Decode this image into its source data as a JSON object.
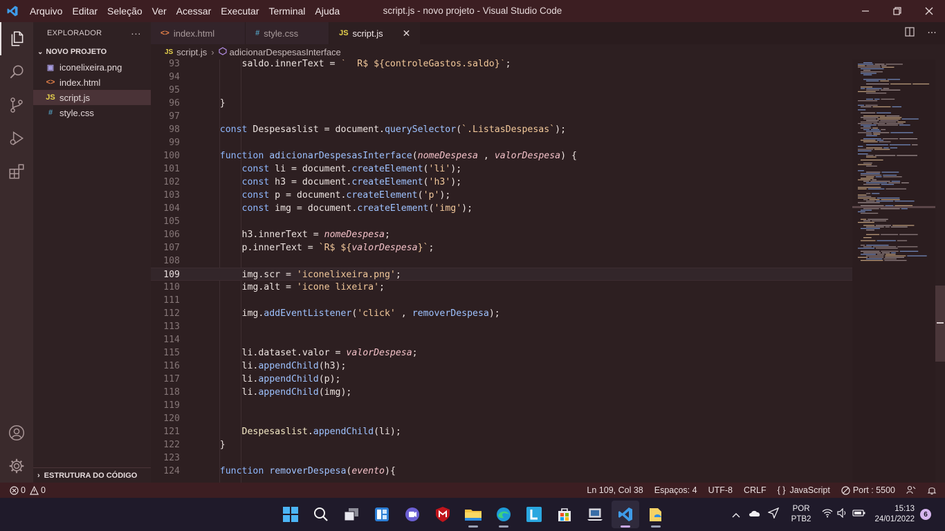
{
  "app": {
    "window_title": "script.js - novo projeto - Visual Studio Code",
    "menu": [
      "Arquivo",
      "Editar",
      "Seleção",
      "Ver",
      "Acessar",
      "Executar",
      "Terminal",
      "Ajuda"
    ]
  },
  "sidebar": {
    "header": "EXPLORADOR",
    "more": "···",
    "project": "NOVO PROJETO",
    "files": [
      {
        "name": "iconelixeira.png",
        "icon": "image-file-icon",
        "glyph": "▣",
        "color": "#a79ce0"
      },
      {
        "name": "index.html",
        "icon": "html-file-icon",
        "glyph": "<>",
        "color": "#e8824a"
      },
      {
        "name": "script.js",
        "icon": "js-file-icon",
        "glyph": "JS",
        "color": "#e8d44d"
      },
      {
        "name": "style.css",
        "icon": "css-file-icon",
        "glyph": "#",
        "color": "#519aba"
      }
    ],
    "outline": "ESTRUTURA DO CÓDIGO"
  },
  "tabs": [
    {
      "label": "index.html",
      "glyph": "<>",
      "color": "#e8824a",
      "active": false
    },
    {
      "label": "style.css",
      "glyph": "#",
      "color": "#519aba",
      "active": false
    },
    {
      "label": "script.js",
      "glyph": "JS",
      "color": "#e8d44d",
      "active": true
    }
  ],
  "breadcrumb": {
    "file": "script.js",
    "file_glyph": "JS",
    "symbol": "adicionarDespesasInterface"
  },
  "editor": {
    "current_line": 109,
    "lines": [
      {
        "n": 93,
        "html": "        saldo.innerText = <span class='st'>`  R$ ${controleGastos.saldo}`</span>;"
      },
      {
        "n": 94,
        "html": ""
      },
      {
        "n": 95,
        "html": ""
      },
      {
        "n": 96,
        "html": "    }"
      },
      {
        "n": 97,
        "html": ""
      },
      {
        "n": 98,
        "html": "    <span class='kw'>const</span> Despesaslist = document.<span class='fn'>querySelector</span>(<span class='st'>`.ListasDespesas`</span>);"
      },
      {
        "n": 99,
        "html": ""
      },
      {
        "n": 100,
        "html": "    <span class='kw'>function</span> <span class='fn'>adicionarDespesasInterface</span>(<span class='pa'>nomeDespesa</span> , <span class='pa'>valorDespesa</span>) {"
      },
      {
        "n": 101,
        "html": "        <span class='kw'>const</span> li = document.<span class='fn'>createElement</span>(<span class='st'>'li'</span>);"
      },
      {
        "n": 102,
        "html": "        <span class='kw'>const</span> h3 = document.<span class='fn'>createElement</span>(<span class='st'>'h3'</span>);"
      },
      {
        "n": 103,
        "html": "        <span class='kw'>const</span> p = document.<span class='fn'>createElement</span>(<span class='st'>'p'</span>);"
      },
      {
        "n": 104,
        "html": "        <span class='kw'>const</span> img = document.<span class='fn'>createElement</span>(<span class='st'>'img'</span>);"
      },
      {
        "n": 105,
        "html": ""
      },
      {
        "n": 106,
        "html": "        h3.innerText = <span class='pa'>nomeDespesa</span>;"
      },
      {
        "n": 107,
        "html": "        p.innerText = <span class='st'>`R$ ${<span class='pa'>valorDespesa</span>}`</span>;"
      },
      {
        "n": 108,
        "html": ""
      },
      {
        "n": 109,
        "html": "        img.scr = <span class='st'>'iconelixeira.png'</span>;"
      },
      {
        "n": 110,
        "html": "        img.alt = <span class='st'>'icone lixeira'</span>;"
      },
      {
        "n": 111,
        "html": ""
      },
      {
        "n": 112,
        "html": "        img.<span class='fn'>addEventListener</span>(<span class='st'>'click'</span> , <span class='fn'>removerDespesa</span>);"
      },
      {
        "n": 113,
        "html": ""
      },
      {
        "n": 114,
        "html": ""
      },
      {
        "n": 115,
        "html": "        li.dataset.valor = <span class='pa'>valorDespesa</span>;"
      },
      {
        "n": 116,
        "html": "        li.<span class='fn'>appendChild</span>(h3);"
      },
      {
        "n": 117,
        "html": "        li.<span class='fn'>appendChild</span>(p);"
      },
      {
        "n": 118,
        "html": "        li.<span class='fn'>appendChild</span>(img);"
      },
      {
        "n": 119,
        "html": ""
      },
      {
        "n": 120,
        "html": ""
      },
      {
        "n": 121,
        "html": "        <span class='pr'>Despesaslist</span>.<span class='fn'>appendChild</span>(li);"
      },
      {
        "n": 122,
        "html": "    }"
      },
      {
        "n": 123,
        "html": ""
      },
      {
        "n": 124,
        "html": "    <span class='kw'>function</span> <span class='fn'>removerDespesa</span>(<span class='pa'>evento</span>){"
      }
    ]
  },
  "statusbar": {
    "errors": "0",
    "warnings": "0",
    "position": "Ln 109, Col 38",
    "spaces": "Espaços: 4",
    "encoding": "UTF-8",
    "eol": "CRLF",
    "language": "JavaScript",
    "port": "Port : 5500"
  },
  "taskbar": {
    "language": "POR",
    "layout": "PTB2",
    "time": "15:13",
    "date": "24/01/2022",
    "notifications": "6"
  }
}
